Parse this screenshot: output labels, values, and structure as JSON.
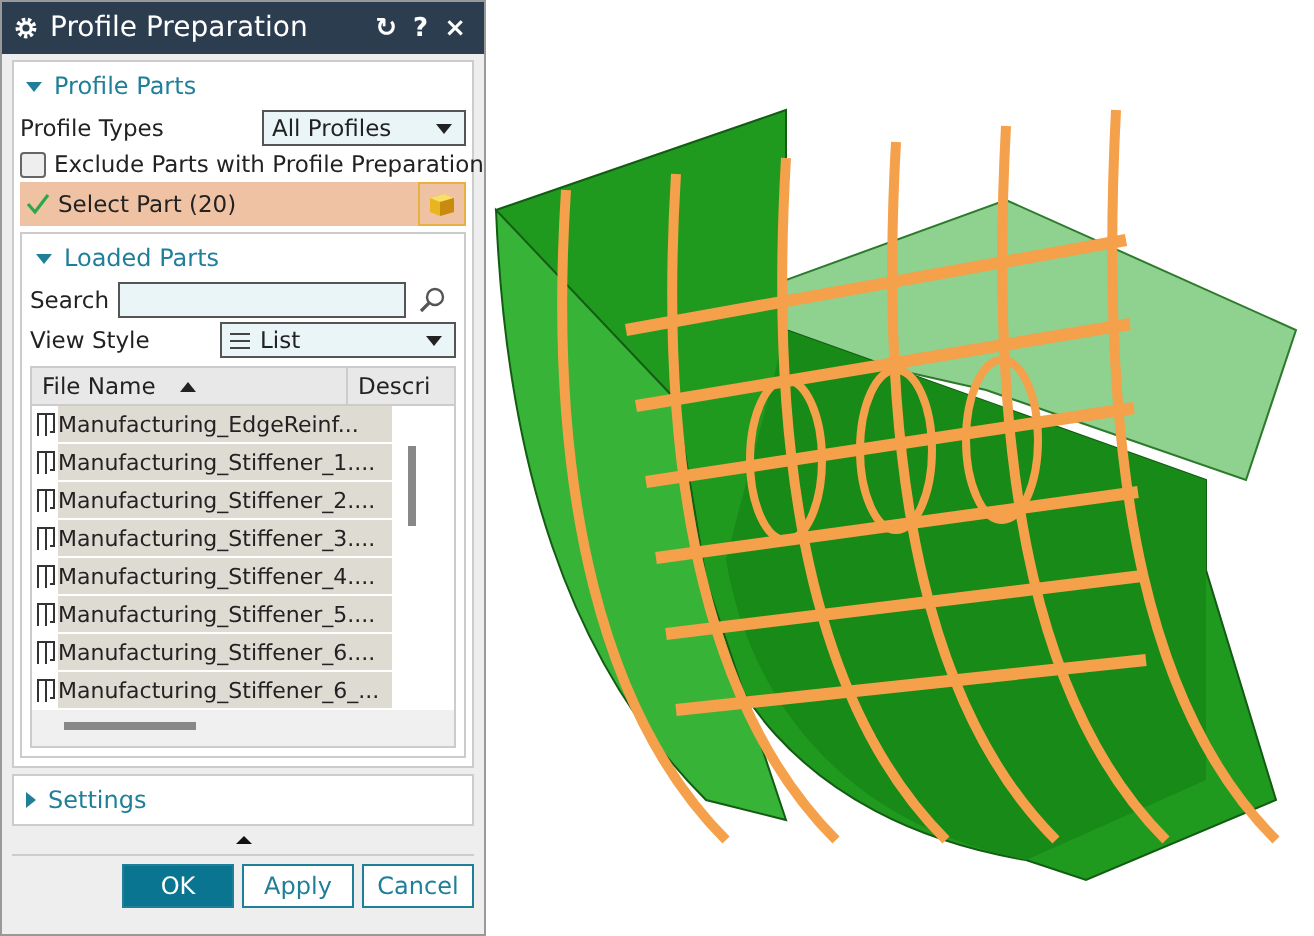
{
  "window": {
    "title": "Profile Preparation",
    "buttons": [
      "↻",
      "?",
      "×"
    ]
  },
  "profile_parts": {
    "title": "Profile Parts",
    "expanded": true,
    "profile_types_label": "Profile Types",
    "profile_types_value": "All Profiles",
    "exclude": {
      "label": "Exclude Parts with Profile Preparation",
      "checked": false
    },
    "select_part": {
      "label": "Select Part (20)",
      "done": true
    }
  },
  "loaded_parts": {
    "title": "Loaded Parts",
    "expanded": true,
    "search_label": "Search",
    "view_style_label": "View Style",
    "view_style_value": "List",
    "table": {
      "columns": [
        "File Name",
        "Descri"
      ],
      "rows": [
        {
          "name": "Manufacturing_EdgeReinf...",
          "selected": true
        },
        {
          "name": "Manufacturing_Stiffener_1....",
          "selected": true
        },
        {
          "name": "Manufacturing_Stiffener_2....",
          "selected": true
        },
        {
          "name": "Manufacturing_Stiffener_3....",
          "selected": true
        },
        {
          "name": "Manufacturing_Stiffener_4....",
          "selected": true
        },
        {
          "name": "Manufacturing_Stiffener_5....",
          "selected": true
        },
        {
          "name": "Manufacturing_Stiffener_6....",
          "selected": true
        },
        {
          "name": "Manufacturing_Stiffener_6_...",
          "selected": true
        }
      ]
    }
  },
  "settings": {
    "title": "Settings",
    "expanded": false
  },
  "buttons": [
    {
      "label": "OK",
      "primary": true
    },
    {
      "label": "Apply",
      "primary": false
    },
    {
      "label": "Cancel",
      "primary": false
    }
  ]
}
